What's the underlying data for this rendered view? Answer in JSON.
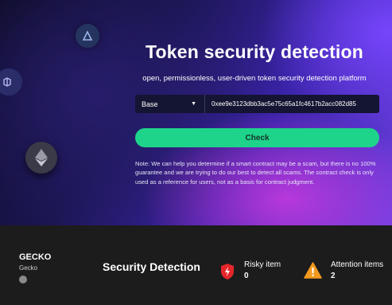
{
  "hero": {
    "title": "Token security detection",
    "subtitle": "open, permissionless, user-driven token security detection platform",
    "chain_select": {
      "selected": "Base"
    },
    "address_input": {
      "value": "0xee9e3123dbb3ac5e75c65a1fc4617b2acc082d85"
    },
    "check_label": "Check",
    "note": "Note: We can help you determine if a smart contract may be a scam, but there is no 100% guarantee and we are trying to do our best to detect all scams. The contract check is only used as a reference for users, not as a basis for contract judgment."
  },
  "token": {
    "name": "GECKO",
    "subname": "Gecko"
  },
  "summary": {
    "title": "Security Detection",
    "risky": {
      "label": "Risky item",
      "count": "0",
      "color": "#e5262b"
    },
    "attention": {
      "label": "Attention items",
      "count": "2",
      "color": "#f29a1e"
    }
  },
  "colors": {
    "accent": "#1ed48a",
    "background_dark": "#1c1c1c"
  }
}
